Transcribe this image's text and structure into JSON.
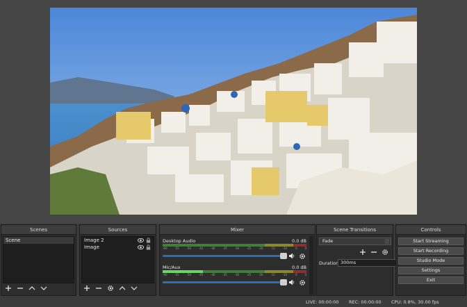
{
  "docks": {
    "scenes": {
      "title": "Scenes",
      "items": [
        "Scene"
      ]
    },
    "sources": {
      "title": "Sources",
      "items": [
        "Image 2",
        "Image"
      ]
    },
    "mixer": {
      "title": "Mixer",
      "tracks": [
        {
          "name": "Desktop Audio",
          "db": "0.0 dB",
          "level": 0.0
        },
        {
          "name": "Mic/Aux",
          "db": "0.0 dB",
          "level": 0.28
        }
      ],
      "tick_labels": [
        "-60",
        "-55",
        "-50",
        "-45",
        "-40",
        "-35",
        "-30",
        "-25",
        "-20",
        "-15",
        "-10",
        "-5",
        "0"
      ]
    },
    "transitions": {
      "title": "Scene Transitions",
      "selected": "Fade",
      "duration_label": "Duration",
      "duration_value": "300ms"
    },
    "controls": {
      "title": "Controls",
      "buttons": [
        "Start Streaming",
        "Start Recording",
        "Studio Mode",
        "Settings",
        "Exit"
      ]
    }
  },
  "statusbar": {
    "live": "LIVE: 00:00:00",
    "rec": "REC: 00:00:00",
    "cpu": "CPU: 0.8%, 30.00 fps"
  },
  "colors": {
    "meter_green": "#3f7f3a",
    "meter_yellow": "#8a8a2c",
    "meter_red": "#8a3030",
    "slider_blue": "#2c6fbd"
  }
}
